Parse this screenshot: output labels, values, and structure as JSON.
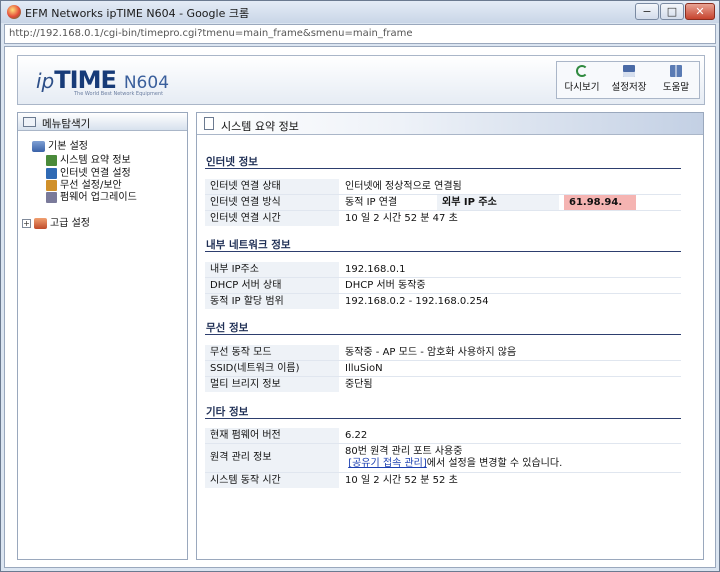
{
  "window": {
    "title": "EFM Networks ipTIME N604 - Google 크롬",
    "minimize": "−",
    "maximize": "□",
    "close": "✕"
  },
  "address": {
    "url": "http://192.168.0.1/cgi-bin/timepro.cgi?tmenu=main_frame&smenu=main_frame"
  },
  "header": {
    "logo_ip": "ip",
    "logo_time": "TIME",
    "logo_model": "N604",
    "tagline": "The World Best Network Equipment",
    "toolbar": [
      {
        "label": "다시보기",
        "icon": "refresh-icon"
      },
      {
        "label": "설정저장",
        "icon": "save-icon"
      },
      {
        "label": "도움말",
        "icon": "help-icon"
      }
    ]
  },
  "menu": {
    "title": "메뉴탐색기",
    "basic_group": "기본 설정",
    "basic_items": [
      {
        "label": "시스템 요약 정보",
        "color": "#4a8a3a"
      },
      {
        "label": "인터넷 연결 설정",
        "color": "#2f6ab4"
      },
      {
        "label": "무선 설정/보안",
        "color": "#d0902a"
      },
      {
        "label": "펌웨어 업그레이드",
        "color": "#7a7a9a"
      }
    ],
    "advanced_group": "고급 설정",
    "advanced_expander": "+"
  },
  "main": {
    "title": "시스템 요약 정보",
    "internet": {
      "heading": "인터넷 정보",
      "rows": [
        {
          "label": "인터넷 연결 상태",
          "value": "인터넷에 정상적으로 연결됨"
        },
        {
          "label": "인터넷 연결 방식",
          "value": "동적 IP 연결",
          "sub_label": "외부 IP 주소",
          "sub_value": "61.98.94."
        },
        {
          "label": "인터넷 연결 시간",
          "value": "10 일 2 시간 52 분 47 초"
        }
      ]
    },
    "lan": {
      "heading": "내부 네트워크 정보",
      "rows": [
        {
          "label": "내부 IP주소",
          "value": "192.168.0.1"
        },
        {
          "label": "DHCP 서버 상태",
          "value": "DHCP 서버 동작중"
        },
        {
          "label": "동적 IP 할당 범위",
          "value": "192.168.0.2 -  192.168.0.254"
        }
      ]
    },
    "wireless": {
      "heading": "무선 정보",
      "rows": [
        {
          "label": "무선 동작 모드",
          "value": "동작중 - AP 모드 - 암호화 사용하지 않음"
        },
        {
          "label": "SSID(네트워크 이름)",
          "value": "IlluSioN"
        },
        {
          "label": "멀티 브리지 정보",
          "value": "중단됨"
        }
      ]
    },
    "other": {
      "heading": "기타 정보",
      "firmware_label": "현재 펌웨어 버전",
      "firmware_value": "6.22",
      "remote_label": "원격 관리 정보",
      "remote_line1": "80번 원격 관리 포트 사용중",
      "remote_link": "[공유기 접속 관리]",
      "remote_line2_suffix": "에서 설정을 변경할 수 있습니다.",
      "uptime_label": "시스템 동작 시간",
      "uptime_value": "10 일 2 시간 52 분 52 초"
    }
  }
}
